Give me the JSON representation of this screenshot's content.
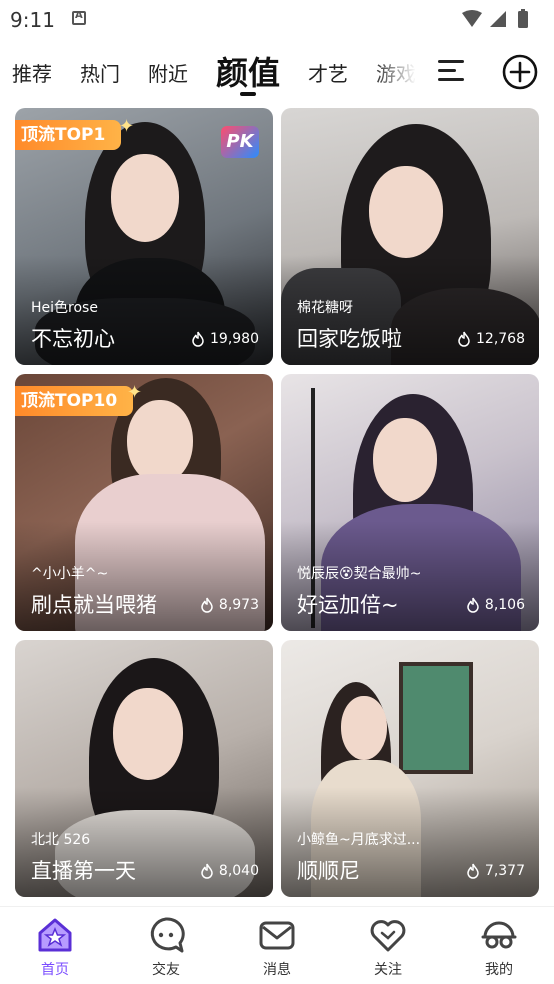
{
  "status_bar": {
    "time": "9:11"
  },
  "tabs": [
    {
      "label": "推荐",
      "active": false
    },
    {
      "label": "热门",
      "active": false
    },
    {
      "label": "附近",
      "active": false
    },
    {
      "label": "颜值",
      "active": true
    },
    {
      "label": "才艺",
      "active": false
    },
    {
      "label": "游戏",
      "active": false
    }
  ],
  "cards": [
    {
      "badge": "顶流TOP1",
      "pk": "PK",
      "username": "Hei色rose",
      "title": "不忘初心",
      "heat": "19,980"
    },
    {
      "badge": "",
      "pk": "",
      "username": "棉花糖呀",
      "title": "回家吃饭啦",
      "heat": "12,768"
    },
    {
      "badge": "顶流TOP10",
      "pk": "",
      "username": "^小小羊^~",
      "title": "刷点就当喂猪",
      "heat": "8,973"
    },
    {
      "badge": "",
      "pk": "",
      "username": "悦辰辰😵契合最帅~",
      "title": "好运加倍~",
      "heat": "8,106"
    },
    {
      "badge": "",
      "pk": "",
      "username": "北北 526",
      "title": "直播第一天",
      "heat": "8,040"
    },
    {
      "badge": "",
      "pk": "",
      "username": "小鲸鱼~月底求过...",
      "title": "顺顺尼",
      "heat": "7,377"
    }
  ],
  "bottom_nav": [
    {
      "label": "首页",
      "icon": "home-icon",
      "active": true
    },
    {
      "label": "交友",
      "icon": "chat-bubble-icon",
      "active": false
    },
    {
      "label": "消息",
      "icon": "mail-icon",
      "active": false
    },
    {
      "label": "关注",
      "icon": "heart-icon",
      "active": false
    },
    {
      "label": "我的",
      "icon": "profile-glasses-icon",
      "active": false
    }
  ],
  "colors": {
    "accent": "#7b4dff",
    "badge": "#ff9a3c"
  }
}
